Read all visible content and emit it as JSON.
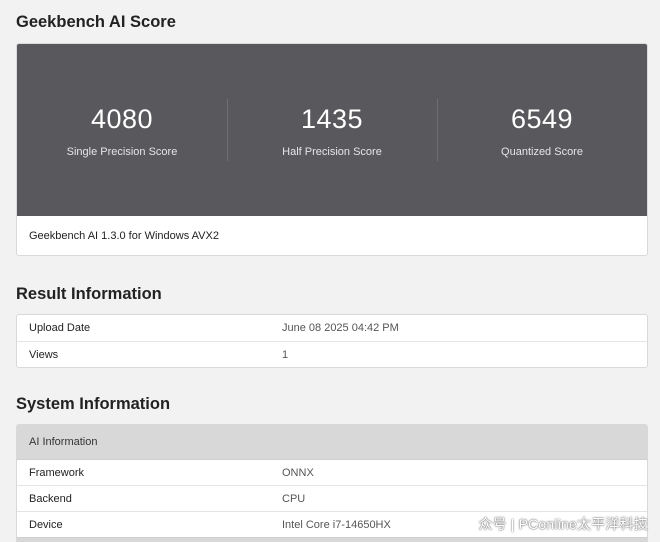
{
  "score_section": {
    "title": "Geekbench AI Score",
    "scores": [
      {
        "value": "4080",
        "label": "Single Precision Score"
      },
      {
        "value": "1435",
        "label": "Half Precision Score"
      },
      {
        "value": "6549",
        "label": "Quantized Score"
      }
    ],
    "version": "Geekbench AI 1.3.0 for Windows AVX2"
  },
  "result_information": {
    "title": "Result Information",
    "rows": [
      {
        "key": "Upload Date",
        "value": "June 08 2025 04:42 PM"
      },
      {
        "key": "Views",
        "value": "1"
      }
    ]
  },
  "system_information": {
    "title": "System Information",
    "group_header": "AI Information",
    "rows": [
      {
        "key": "Framework",
        "value": "ONNX"
      },
      {
        "key": "Backend",
        "value": "CPU"
      },
      {
        "key": "Device",
        "value": "Intel Core i7-14650HX"
      }
    ]
  },
  "watermark": {
    "prefix": "众号",
    "separator": "|",
    "text": "PConline太平洋科技"
  },
  "colors": {
    "page_bg": "#f2f2f2",
    "score_band": "#58585d",
    "table_header_bg": "#d8d8d8"
  }
}
